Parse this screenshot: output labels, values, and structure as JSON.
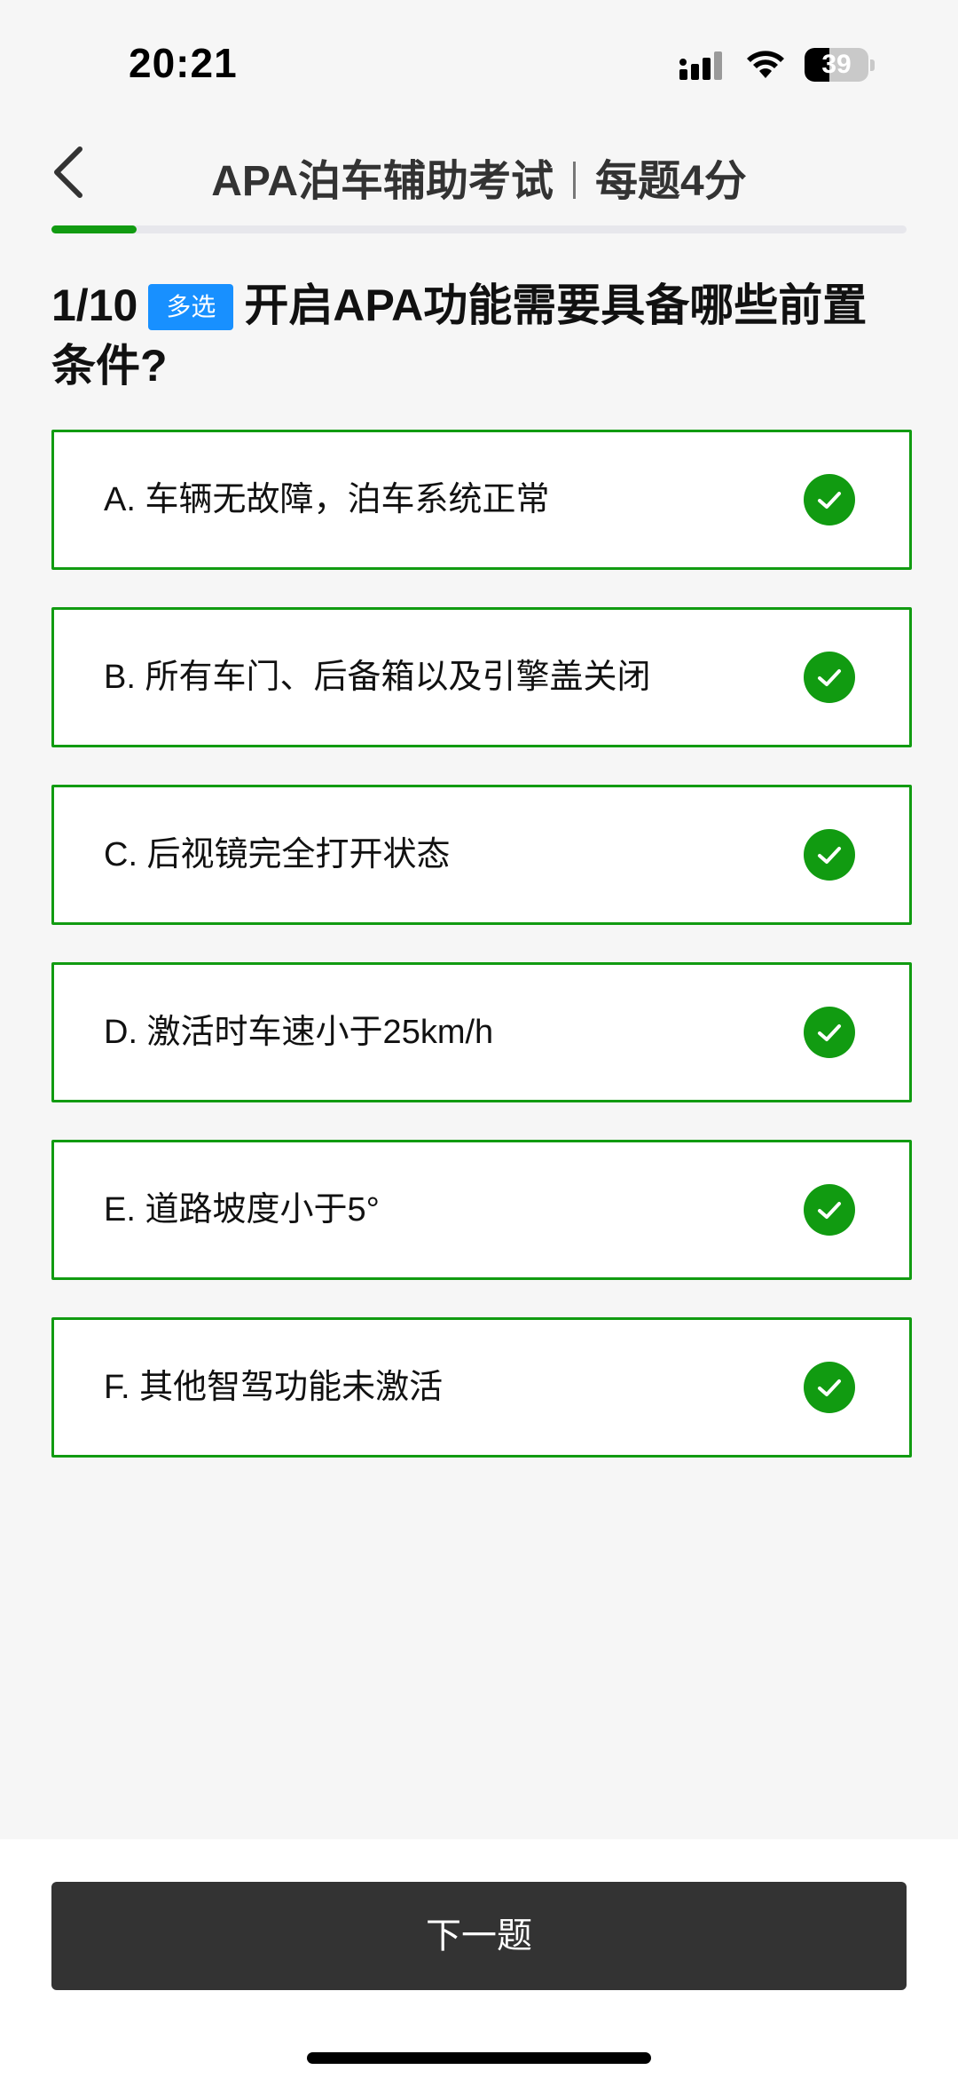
{
  "status": {
    "time": "20:21",
    "battery": "39",
    "battery_level": 0.39,
    "icons": [
      "signal-icon",
      "wifi-icon",
      "battery-icon"
    ]
  },
  "nav": {
    "back_icon": "chevron-left-icon",
    "title": "APA泊车辅助考试",
    "subtitle": "每题4分"
  },
  "progress": {
    "current": 1,
    "total": 10
  },
  "question": {
    "number": "1/10",
    "type_tag": "多选",
    "text": "开启APA功能需要具备哪些前置条件?"
  },
  "options": [
    {
      "label": "A. 车辆无故障，泊车系统正常",
      "selected": true
    },
    {
      "label": "B. 所有车门、后备箱以及引擎盖关闭",
      "selected": true
    },
    {
      "label": "C. 后视镜完全打开状态",
      "selected": true
    },
    {
      "label": "D. 激活时车速小于25km/h",
      "selected": true
    },
    {
      "label": "E. 道路坡度小于5°",
      "selected": true
    },
    {
      "label": "F. 其他智驾功能未激活",
      "selected": true
    }
  ],
  "footer": {
    "next_label": "下一题"
  },
  "colors": {
    "accent": "#119b11",
    "tag": "#1890ff",
    "button": "#333333"
  }
}
